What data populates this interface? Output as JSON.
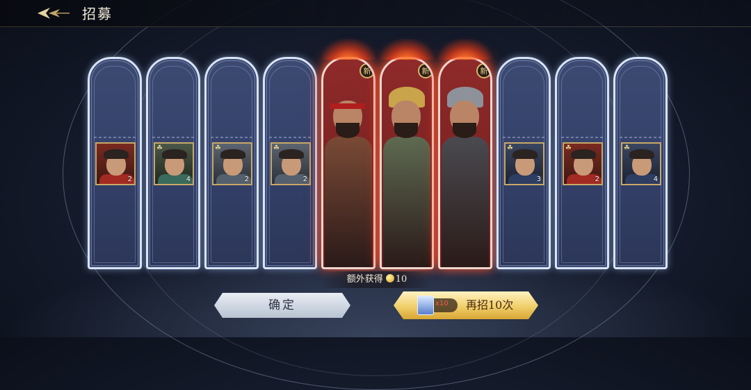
{
  "header": {
    "title": "招募",
    "back_icon": "back-arrow-icon"
  },
  "cards": [
    {
      "type": "blue",
      "count": "2",
      "tone": "p-red",
      "clover": false
    },
    {
      "type": "blue",
      "count": "4",
      "tone": "p-teal",
      "clover": true
    },
    {
      "type": "blue",
      "count": "2",
      "tone": "p-steel",
      "clover": true
    },
    {
      "type": "blue",
      "count": "2",
      "tone": "p-steel",
      "clover": true
    },
    {
      "type": "red",
      "badge": "新",
      "hero": "red-band"
    },
    {
      "type": "red",
      "badge": "新",
      "hero": "gold-helm"
    },
    {
      "type": "red",
      "badge": "新",
      "hero": "steel-helm"
    },
    {
      "type": "blue",
      "count": "3",
      "tone": "p-navy",
      "clover": true
    },
    {
      "type": "blue",
      "count": "2",
      "tone": "p-red",
      "clover": true
    },
    {
      "type": "blue",
      "count": "4",
      "tone": "p-navy",
      "clover": true
    }
  ],
  "extra": {
    "label": "额外获得",
    "amount": "10"
  },
  "buttons": {
    "confirm": "确定",
    "again": "再招10次",
    "again_cost": "x10"
  },
  "colors": {
    "accent_gold": "#f0cf6a",
    "new_red": "#8f2a2a",
    "card_blue": "#3c4a72"
  }
}
